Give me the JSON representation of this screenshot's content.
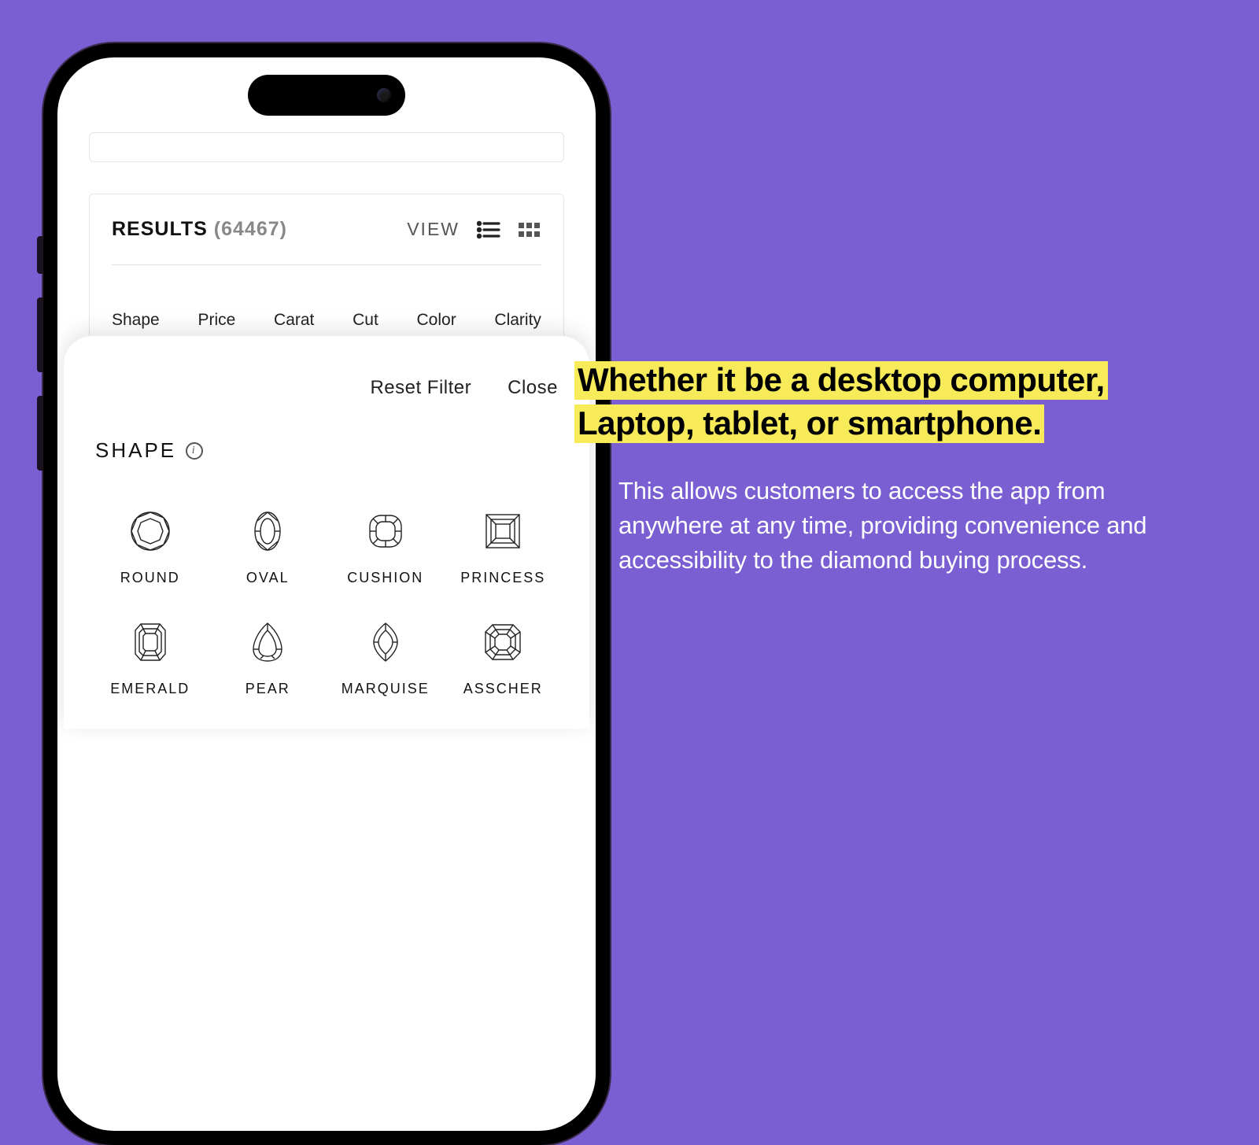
{
  "results": {
    "label": "RESULTS",
    "count": "(64467)",
    "view_label": "VIEW"
  },
  "filters": {
    "items": [
      "Shape",
      "Price",
      "Carat",
      "Cut",
      "Color",
      "Clarity"
    ]
  },
  "sheet": {
    "reset": "Reset Filter",
    "close": "Close",
    "title": "SHAPE",
    "shapes": [
      "ROUND",
      "OVAL",
      "CUSHION",
      "PRINCESS",
      "EMERALD",
      "PEAR",
      "MARQUISE",
      "ASSCHER"
    ]
  },
  "copy": {
    "headline": "Whether it be a desktop computer, Laptop, tablet, or smartphone.",
    "body": "This allows customers to access the app from anywhere at any time, providing convenience and accessibility to the diamond buying process."
  }
}
